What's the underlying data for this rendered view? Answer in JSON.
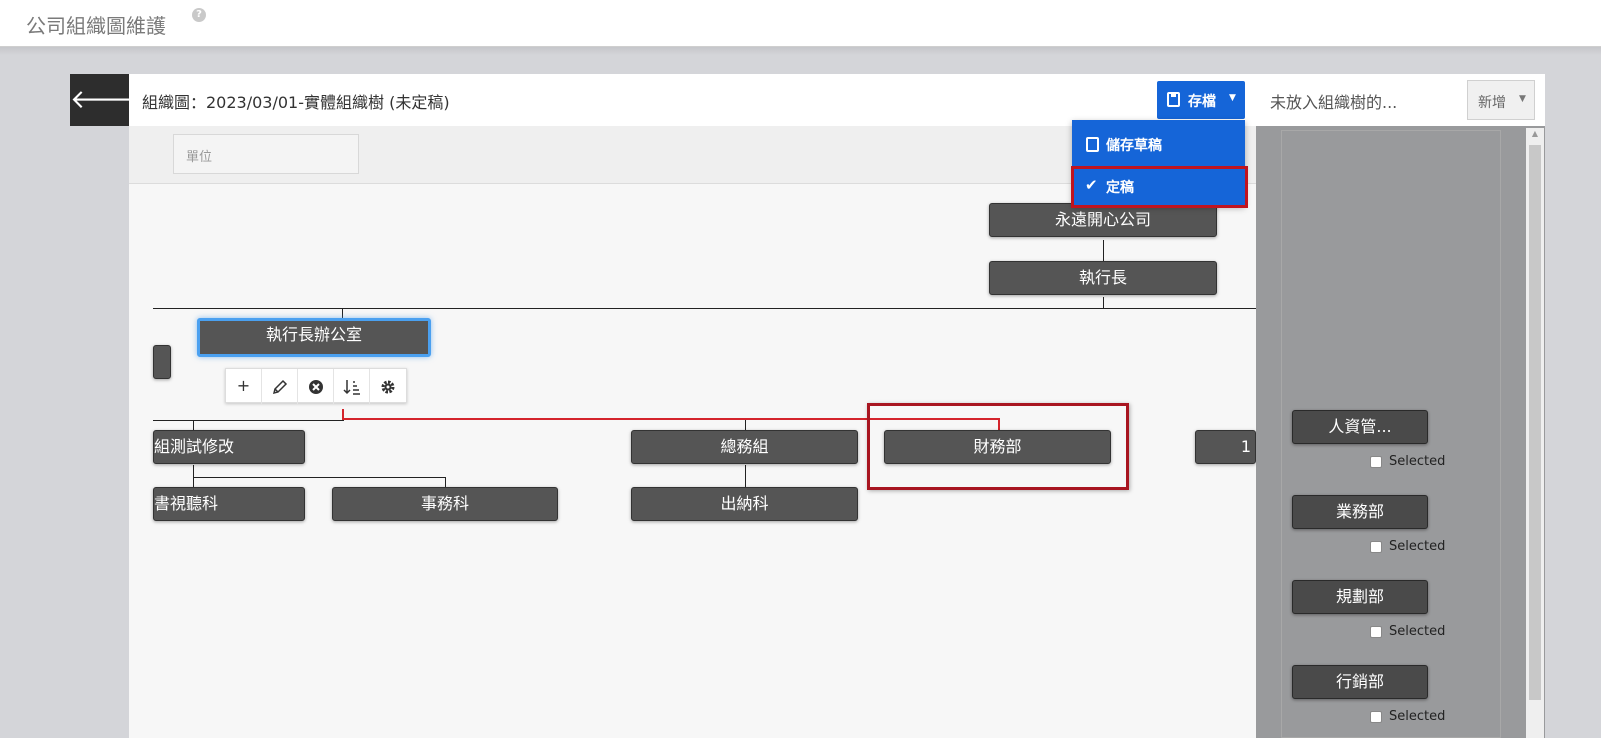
{
  "header": {
    "title": "公司組織圖維護",
    "help_icon": "question-circle-icon"
  },
  "toolbar": {
    "back_icon": "arrow-left-icon",
    "chart_title": "組織圖：2023/03/01-實體組織樹 (未定稿)",
    "save_label": "存檔",
    "save_menu": {
      "save_draft": "儲存草稿",
      "finalize": "定稿"
    }
  },
  "filter": {
    "unit_placeholder": "單位"
  },
  "org_chart": {
    "company": "永遠開心公司",
    "ceo": "執行長",
    "ceo_office": "執行長辦公室",
    "test_group": "組測試修改",
    "av_section": "書視聽科",
    "affairs_section": "事務科",
    "general_affairs": "總務組",
    "cashier": "出納科",
    "finance": "財務部",
    "right_partial": "1"
  },
  "node_toolbar": {
    "add": "+",
    "edit": "pencil-icon",
    "delete": "times-circle-icon",
    "sort": "sort-icon",
    "settings": "gear-icon"
  },
  "unplaced_panel": {
    "title": "未放入組織樹的...",
    "add_label": "新增",
    "items": [
      {
        "label": "人資管...",
        "selected_label": "Selected"
      },
      {
        "label": "業務部",
        "selected_label": "Selected"
      },
      {
        "label": "規劃部",
        "selected_label": "Selected"
      },
      {
        "label": "行銷部",
        "selected_label": "Selected"
      }
    ]
  },
  "colors": {
    "primary": "#1565d8",
    "node": "#555555",
    "highlight": "#c0141f",
    "panel": "#999a9c"
  }
}
